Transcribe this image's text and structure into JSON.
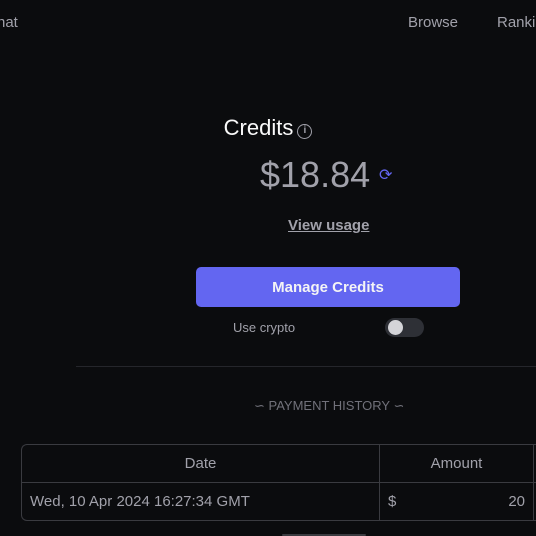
{
  "nav": {
    "chat": "hat",
    "browse": "Browse",
    "rankings": "Ranki"
  },
  "credits": {
    "title": "Credits",
    "info_icon": "info-icon",
    "balance": "$18.84",
    "refresh_icon": "refresh-icon",
    "view_usage": "View usage"
  },
  "actions": {
    "manage_credits": "Manage Credits",
    "use_crypto_label": "Use crypto",
    "use_crypto_enabled": false
  },
  "payment_history": {
    "heading": "∽ PAYMENT HISTORY ∽",
    "columns": [
      "Date",
      "Amount"
    ],
    "rows": [
      {
        "date": "Wed, 10 Apr 2024 16:27:34 GMT",
        "currency": "$",
        "amount": "20"
      }
    ]
  },
  "colors": {
    "accent": "#6366f1",
    "background": "#0b0c0e"
  }
}
